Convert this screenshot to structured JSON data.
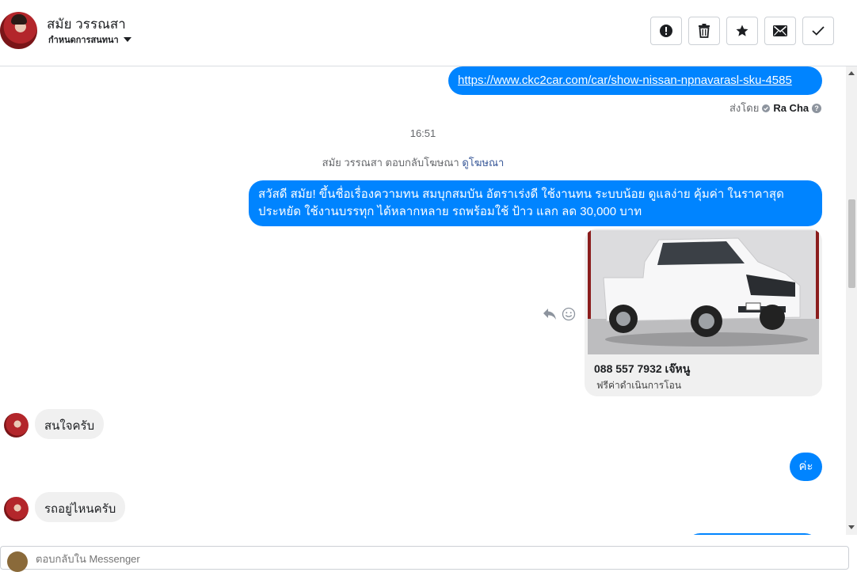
{
  "header": {
    "contact_name": "สมัย วรรณสา",
    "assign_label": "กำหนดการสนทนา",
    "actions": [
      {
        "name": "spam-button",
        "icon": "exclamation-circle-icon"
      },
      {
        "name": "delete-button",
        "icon": "trash-icon"
      },
      {
        "name": "star-button",
        "icon": "star-icon"
      },
      {
        "name": "mark-unread-button",
        "icon": "envelope-icon"
      },
      {
        "name": "done-button",
        "icon": "check-icon"
      }
    ]
  },
  "thread": {
    "link_message": "https://www.ckc2car.com/car/show-nissan-npnavarasl-sku-4585",
    "sent_by_prefix": "ส่งโดย",
    "sent_by_name": "Ra Cha",
    "timestamp": "16:51",
    "ad_reply_text": "สมัย วรรณสา ตอบกลับโฆษณา",
    "ad_reply_link": "ดูโฆษณา",
    "promo_message": "สวัสดี สมัย! ขึ้นชื่อเรื่องความทน สมบุกสมบัน อัตราเร่งดี ใช้งานทน ระบบน้อย ดูแลง่าย คุ้มค่า ในราคาสุด ประหยัด ใช้งานบรรทุก ได้หลากหลาย รถพร้อมใช้ ป้าว แลก ลด 30,000 บาท",
    "card_title": "088 557 7932 เจ๊หนู",
    "card_subtitle": "ฟรีค่าดำเนินการโอน",
    "incoming_1": "สนใจครับ",
    "outgoing_short": "ค่ะ",
    "incoming_2": "รถอยู่ไหนครับ"
  },
  "composer": {
    "placeholder": "ตอบกลับใน Messenger"
  },
  "colors": {
    "brand_blue": "#0084ff",
    "incoming_bg": "#f0f0f0"
  }
}
